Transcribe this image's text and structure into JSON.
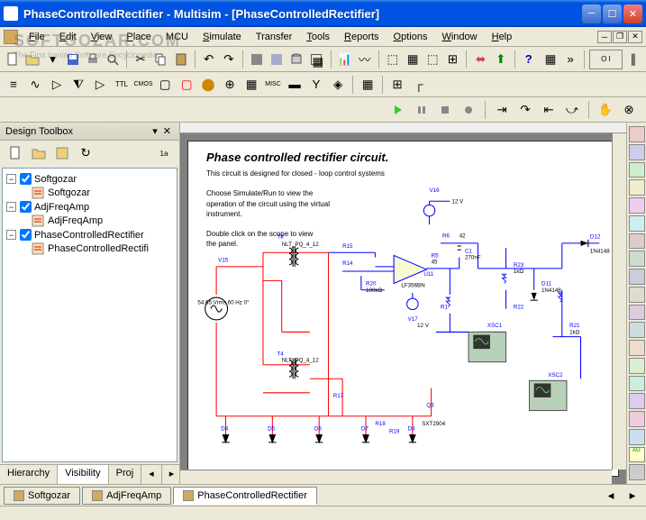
{
  "window": {
    "title": "PhaseControlledRectifier - Multisim - [PhaseControlledRectifier]"
  },
  "menu": {
    "file": "File",
    "edit": "Edit",
    "view": "View",
    "place": "Place",
    "mcu": "MCU",
    "simulate": "Simulate",
    "transfer": "Transfer",
    "tools": "Tools",
    "reports": "Reports",
    "options": "Options",
    "window": "Window",
    "help": "Help"
  },
  "sidebar": {
    "title": "Design Toolbox",
    "projects": [
      {
        "name": "Softgozar",
        "child": "Softgozar"
      },
      {
        "name": "AdjFreqAmp",
        "child": "AdjFreqAmp"
      },
      {
        "name": "PhaseControlledRectifier",
        "child": "PhaseControlledRectifi"
      }
    ],
    "tabs": {
      "hierarchy": "Hierarchy",
      "visibility": "Visibility",
      "project": "Proj"
    }
  },
  "canvas": {
    "title": "Phase controlled rectifier circuit.",
    "desc1": "This circuit is designed for closed - loop control systems",
    "desc2": "Choose Simulate/Run to view the operation of the circuit using the virtual instrument.",
    "desc3": "Double click on the scope to view the panel.",
    "components": {
      "source": "54.65 Vrms\n60 Hz\n0°",
      "v15": "V15",
      "t3": "T3",
      "t4": "T4",
      "nlt1": "NLT_PQ_4_12",
      "nlt2": "NLT_PQ_4_12",
      "r20": "R20",
      "r20v": "100kΩ",
      "u11": "U11",
      "lf": "LF356BN",
      "c1": "C1",
      "c1v": "270nF",
      "r5": "R5",
      "r5v": "45",
      "r6": "R6",
      "r6v": "42",
      "v16": "V16",
      "v16v": "12 V",
      "v17": "V17",
      "v17v": "12 V",
      "r23": "R23",
      "r23v": "1kΩ",
      "d11": "D11",
      "d11v": "1N4148",
      "d12": "D12",
      "d12v": "1N4148",
      "r21": "R21",
      "r21v": "1kΩ",
      "r22": "R22",
      "xsc1": "XSC1",
      "xsc2": "XSC2",
      "d4": "D4",
      "d5": "D5",
      "d6": "D6",
      "d7": "D7",
      "d8": "D8",
      "r18": "R18",
      "r19": "R19",
      "r17": "R17",
      "r15": "R15",
      "r14": "R14",
      "r1": "R1",
      "q3": "Q3",
      "sxt": "SXT2904"
    }
  },
  "doctabs": {
    "t1": "Softgozar",
    "t2": "AdjFreqAmp",
    "t3": "PhaseControlledRectifier"
  },
  "watermark": {
    "main": "SOFTGOZAR.COM",
    "sub": "The First Iranian Software Encyclopedia"
  }
}
